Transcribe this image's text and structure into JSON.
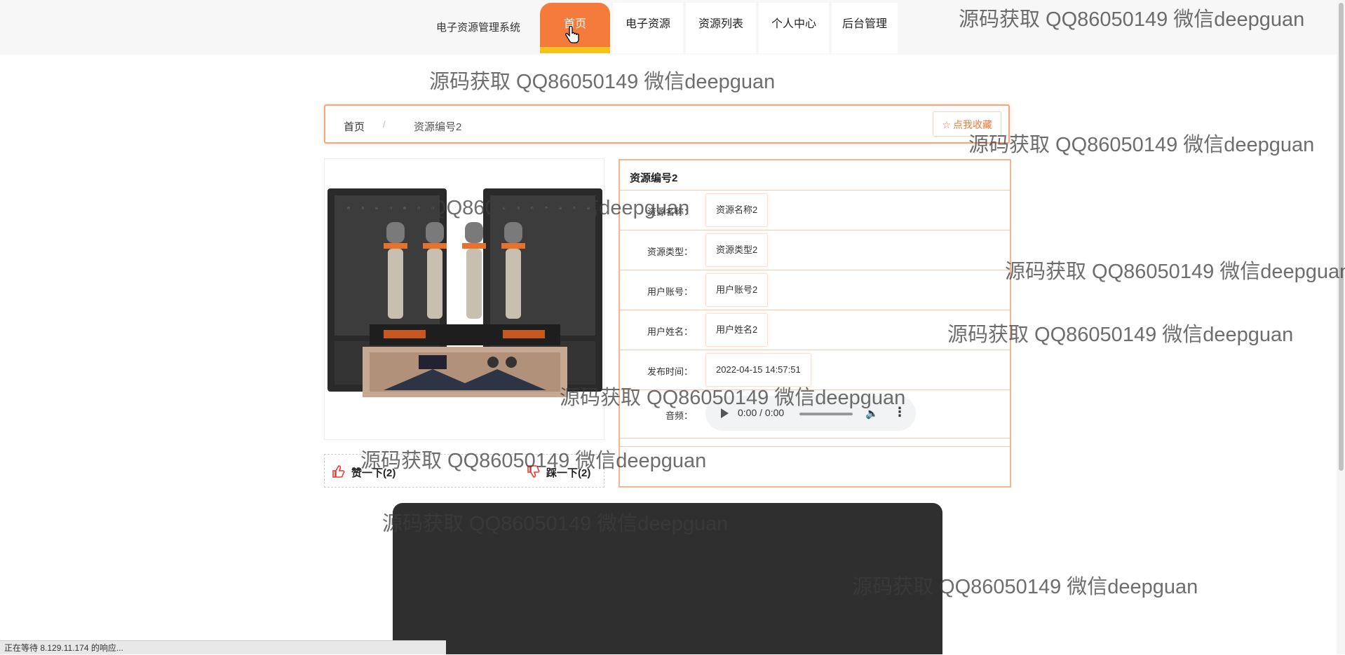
{
  "nav": {
    "brand": "电子资源管理系统",
    "items": [
      "首页",
      "电子资源",
      "资源列表",
      "个人中心",
      "后台管理"
    ],
    "active_index": 0
  },
  "breadcrumb": {
    "home": "首页",
    "separator": "/",
    "current": "资源编号2",
    "favorite_label": "点我收藏"
  },
  "votes": {
    "like_label": "赞一下(2)",
    "dislike_label": "踩一下(2)"
  },
  "detail": {
    "title": "资源编号2",
    "fields": [
      {
        "label": "资源名称：",
        "value": "资源名称2"
      },
      {
        "label": "资源类型：",
        "value": "资源类型2"
      },
      {
        "label": "用户账号：",
        "value": "用户账号2"
      },
      {
        "label": "用户姓名：",
        "value": "用户姓名2"
      },
      {
        "label": "发布时间：",
        "value": "2022-04-15 14:57:51"
      }
    ],
    "audio_label": "音频：",
    "audio_time": "0:00 / 0:00"
  },
  "status_bar": "正在等待 8.129.11.174 的响应...",
  "watermark": "源码获取 QQ86050149 微信deepguan",
  "colors": {
    "accent": "#f47b3c",
    "accent_underline": "#f6c21c",
    "border": "#f5b58f",
    "dark_panel": "#2f2f2f"
  },
  "icons": [
    "cursor-hand-icon",
    "star-icon",
    "thumbs-up-icon",
    "thumbs-down-icon",
    "play-icon",
    "volume-icon",
    "more-vert-icon"
  ]
}
